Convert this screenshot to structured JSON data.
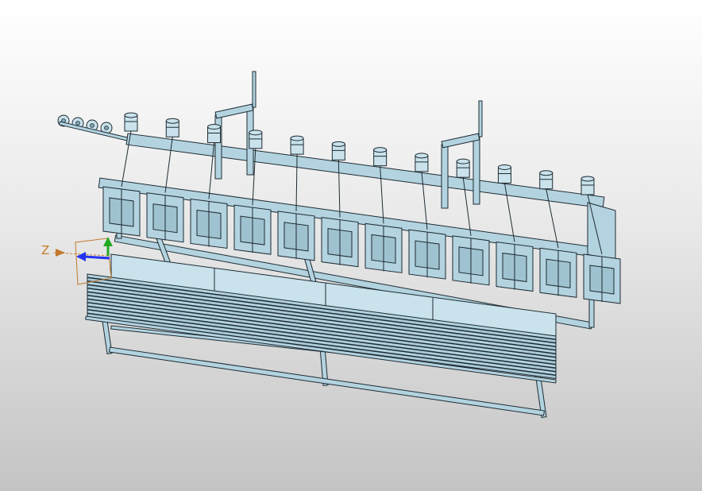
{
  "viewport": {
    "background_top": "#ffffff",
    "background_bottom": "#c4c4c4",
    "model": {
      "fill": "#b3d3e0",
      "fill_light": "#c9e2ec",
      "edge": "#1e2b32",
      "motor_count": 12,
      "roller_count": 4
    }
  },
  "triad": {
    "z_label": "Z",
    "axis_colors": {
      "x": "#2233ee",
      "y": "#22aa22",
      "z": "#c27a2c"
    },
    "box_color": "#c27a2c"
  }
}
